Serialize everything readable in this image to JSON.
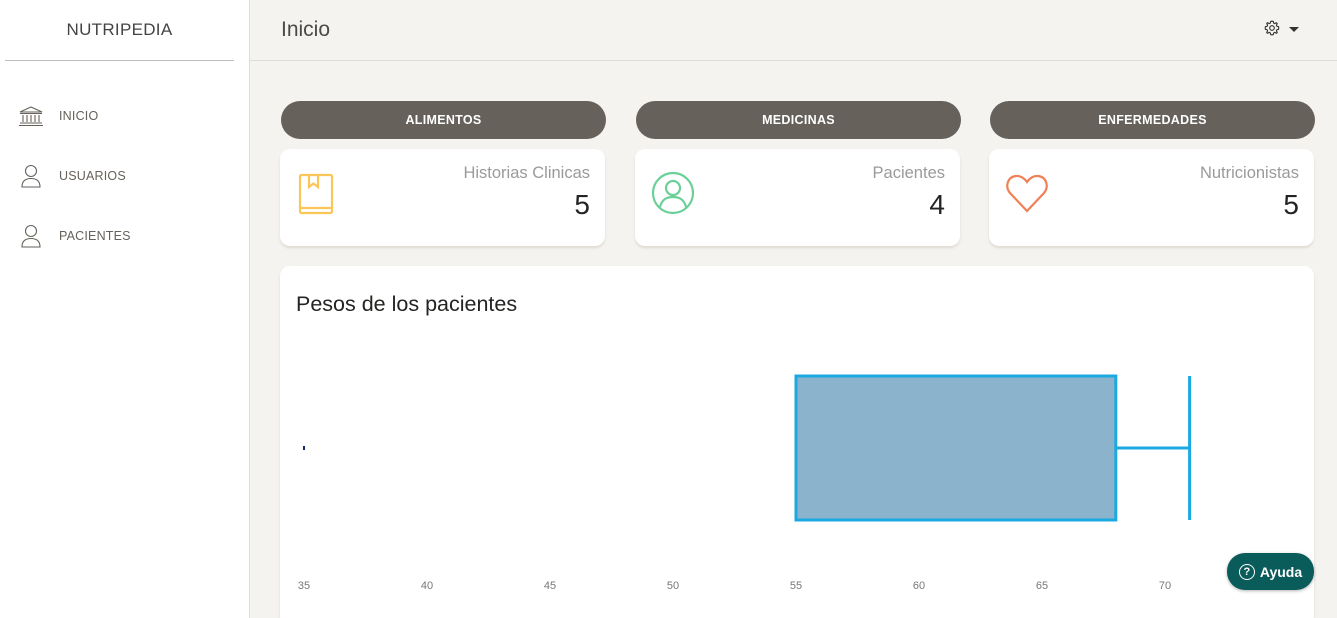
{
  "app": {
    "brand": "NUTRIPEDIA"
  },
  "sidebar": {
    "items": [
      {
        "label": "INICIO",
        "icon": "bank-icon"
      },
      {
        "label": "USUARIOS",
        "icon": "user-icon"
      },
      {
        "label": "PACIENTES",
        "icon": "user-icon"
      }
    ]
  },
  "header": {
    "title": "Inicio",
    "settings_icon": "gear-icon"
  },
  "pills": [
    {
      "label": "ALIMENTOS"
    },
    {
      "label": "MEDICINAS"
    },
    {
      "label": "ENFERMEDADES"
    }
  ],
  "stats": [
    {
      "title": "Historias Clinicas",
      "value": "5",
      "icon": "book-icon",
      "color": "#fbc658"
    },
    {
      "title": "Pacientes",
      "value": "4",
      "icon": "user-circle-icon",
      "color": "#6bd098"
    },
    {
      "title": "Nutricionistas",
      "value": "5",
      "icon": "heart-icon",
      "color": "#ef8157"
    }
  ],
  "chart": {
    "title": "Pesos de los pacientes"
  },
  "chart_data": {
    "type": "boxplot",
    "title": "Pesos de los pacientes",
    "xlim": [
      35,
      73
    ],
    "xticks": [
      35,
      40,
      45,
      50,
      55,
      60,
      65,
      70
    ],
    "box": {
      "min": 35,
      "q1": 55,
      "q3": 68,
      "max": 71
    },
    "box_fill": "#8bb3cc",
    "box_stroke": "#1aa9e0"
  },
  "help": {
    "label": "Ayuda"
  }
}
